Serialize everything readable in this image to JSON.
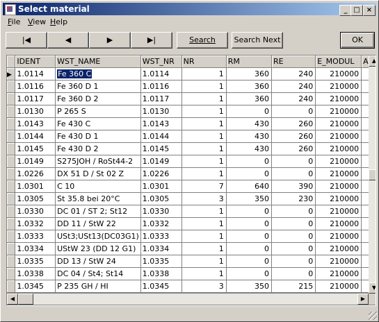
{
  "window": {
    "title": "Select material"
  },
  "title_buttons": {
    "minimize": "_",
    "maximize": "□",
    "close": "×"
  },
  "menu": [
    {
      "label": "File",
      "u": "F",
      "rest": "ile"
    },
    {
      "label": "View",
      "u": "V",
      "rest": "iew"
    },
    {
      "label": "Help",
      "u": "H",
      "rest": "elp"
    }
  ],
  "toolbar": {
    "first": "|◀",
    "prev": "◀",
    "next": "▶",
    "last": "▶|",
    "search": "Search",
    "search_next": "Search Next",
    "ok": "OK"
  },
  "grid": {
    "columns": [
      "IDENT",
      "WST_NAME",
      "WST_NR",
      "NR",
      "RM",
      "RE",
      "E_MODUL",
      "A"
    ],
    "current_row_marker": "▶",
    "rows": [
      [
        "1.0114",
        "Fe 360 C",
        "1.0114",
        "1",
        "360",
        "240",
        "210000"
      ],
      [
        "1.0116",
        "Fe 360 D 1",
        "1.0116",
        "1",
        "360",
        "240",
        "210000"
      ],
      [
        "1.0117",
        "Fe 360 D 2",
        "1.0117",
        "1",
        "360",
        "240",
        "210000"
      ],
      [
        "1.0130",
        "P 265 S",
        "1.0130",
        "1",
        "0",
        "0",
        "210000"
      ],
      [
        "1.0143",
        "Fe 430 C",
        "1.0143",
        "1",
        "430",
        "260",
        "210000"
      ],
      [
        "1.0144",
        "Fe 430 D 1",
        "1.0144",
        "1",
        "430",
        "260",
        "210000"
      ],
      [
        "1.0145",
        "Fe 430 D 2",
        "1.0145",
        "1",
        "430",
        "260",
        "210000"
      ],
      [
        "1.0149",
        "S275JOH / RoSt44-2",
        "1.0149",
        "1",
        "0",
        "0",
        "210000"
      ],
      [
        "1.0226",
        "DX 51 D / St 02 Z",
        "1.0226",
        "1",
        "0",
        "0",
        "210000"
      ],
      [
        "1.0301",
        "C 10",
        "1.0301",
        "7",
        "640",
        "390",
        "210000"
      ],
      [
        "1.0305",
        "St 35.8 bei 20°C",
        "1.0305",
        "3",
        "350",
        "230",
        "210000"
      ],
      [
        "1.0330",
        "DC 01 / ST 2; St12",
        "1.0330",
        "1",
        "0",
        "0",
        "210000"
      ],
      [
        "1.0332",
        "DD 11 / StW 22",
        "1.0332",
        "1",
        "0",
        "0",
        "210000"
      ],
      [
        "1.0333",
        "USt3;USt13(DC03G1)",
        "1.0333",
        "1",
        "0",
        "0",
        "210000"
      ],
      [
        "1.0334",
        "UStW 23 (DD 12 G1)",
        "1.0334",
        "1",
        "0",
        "0",
        "210000"
      ],
      [
        "1.0335",
        "DD 13 / StW 24",
        "1.0335",
        "1",
        "0",
        "0",
        "210000"
      ],
      [
        "1.0338",
        "DC 04 / St4; St14",
        "1.0338",
        "1",
        "0",
        "0",
        "210000"
      ],
      [
        "1.0345",
        "P 235 GH / HI",
        "1.0345",
        "3",
        "350",
        "215",
        "210000"
      ]
    ]
  },
  "scroll": {
    "up": "▲",
    "down": "▼",
    "left": "◀",
    "right": "▶"
  },
  "colors": {
    "title_start": "#0a246a",
    "title_end": "#a6caf0",
    "selection": "#0a246a"
  }
}
